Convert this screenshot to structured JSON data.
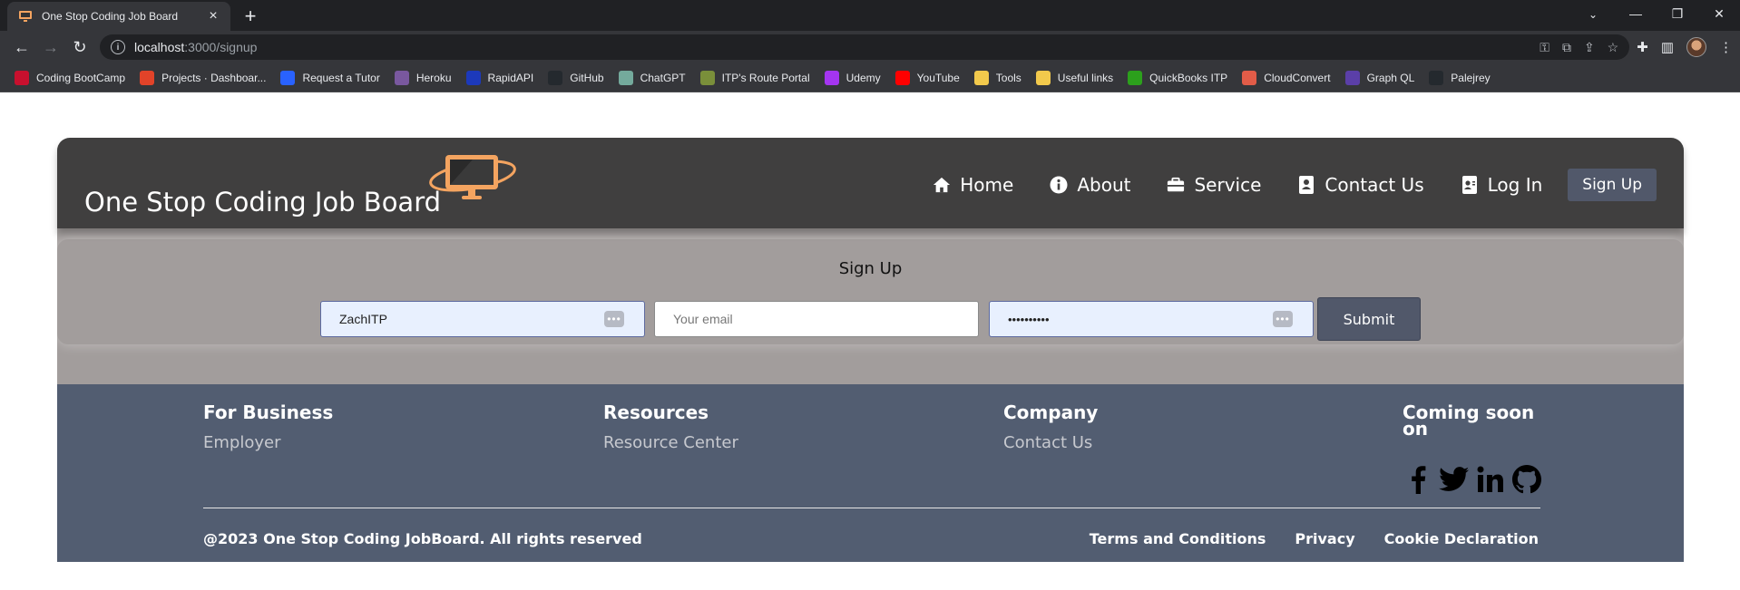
{
  "browser": {
    "tab_title": "One Stop Coding Job Board",
    "new_tab": "+",
    "url_host": "localhost",
    "url_path": ":3000/signup",
    "bookmarks": [
      {
        "label": "Coding BootCamp",
        "color": "#c8102e"
      },
      {
        "label": "Projects · Dashboar...",
        "color": "#e24329"
      },
      {
        "label": "Request a Tutor",
        "color": "#2962ff"
      },
      {
        "label": "Heroku",
        "color": "#79589f"
      },
      {
        "label": "RapidAPI",
        "color": "#1c39bb"
      },
      {
        "label": "GitHub",
        "color": "#24292e"
      },
      {
        "label": "ChatGPT",
        "color": "#74aa9c"
      },
      {
        "label": "ITP's Route Portal",
        "color": "#7a8f3a"
      },
      {
        "label": "Udemy",
        "color": "#a435f0"
      },
      {
        "label": "YouTube",
        "color": "#ff0000"
      },
      {
        "label": "Tools",
        "color": "#f2c94c"
      },
      {
        "label": "Useful links",
        "color": "#f2c94c"
      },
      {
        "label": "QuickBooks ITP",
        "color": "#2ca01c"
      },
      {
        "label": "CloudConvert",
        "color": "#e25c48"
      },
      {
        "label": "Graph QL",
        "color": "#5b3fa8"
      },
      {
        "label": "Palejrey",
        "color": "#24292e"
      }
    ]
  },
  "header": {
    "brand": "One Stop Coding Job Board",
    "nav": [
      {
        "label": "Home",
        "icon": "home-icon"
      },
      {
        "label": "About",
        "icon": "info-icon"
      },
      {
        "label": "Service",
        "icon": "briefcase-icon"
      },
      {
        "label": "Contact Us",
        "icon": "contact-book-icon"
      },
      {
        "label": "Log In",
        "icon": "id-card-icon"
      }
    ],
    "signup_label": "Sign Up"
  },
  "signup": {
    "title": "Sign Up",
    "username_value": "ZachITP",
    "email_placeholder": "Your email",
    "password_masked": "••••••••••",
    "submit_label": "Submit"
  },
  "footer": {
    "columns": [
      {
        "heading": "For Business",
        "link": "Employer"
      },
      {
        "heading": "Resources",
        "link": "Resource Center"
      },
      {
        "heading": "Company",
        "link": "Contact Us"
      },
      {
        "heading": "Coming soon on",
        "link": ""
      }
    ],
    "social": [
      "facebook-icon",
      "twitter-icon",
      "linkedin-icon",
      "github-icon"
    ],
    "copyright": "@2023 One Stop Coding JobBoard. All rights reserved",
    "legal": [
      "Terms and Conditions",
      "Privacy",
      "Cookie Declaration"
    ]
  },
  "colors": {
    "header_bg": "#403f3f",
    "accent_logo": "#f4a460",
    "section_bg": "#a29d9c",
    "footer_bg": "#525d71",
    "button_bg": "#51586a"
  }
}
